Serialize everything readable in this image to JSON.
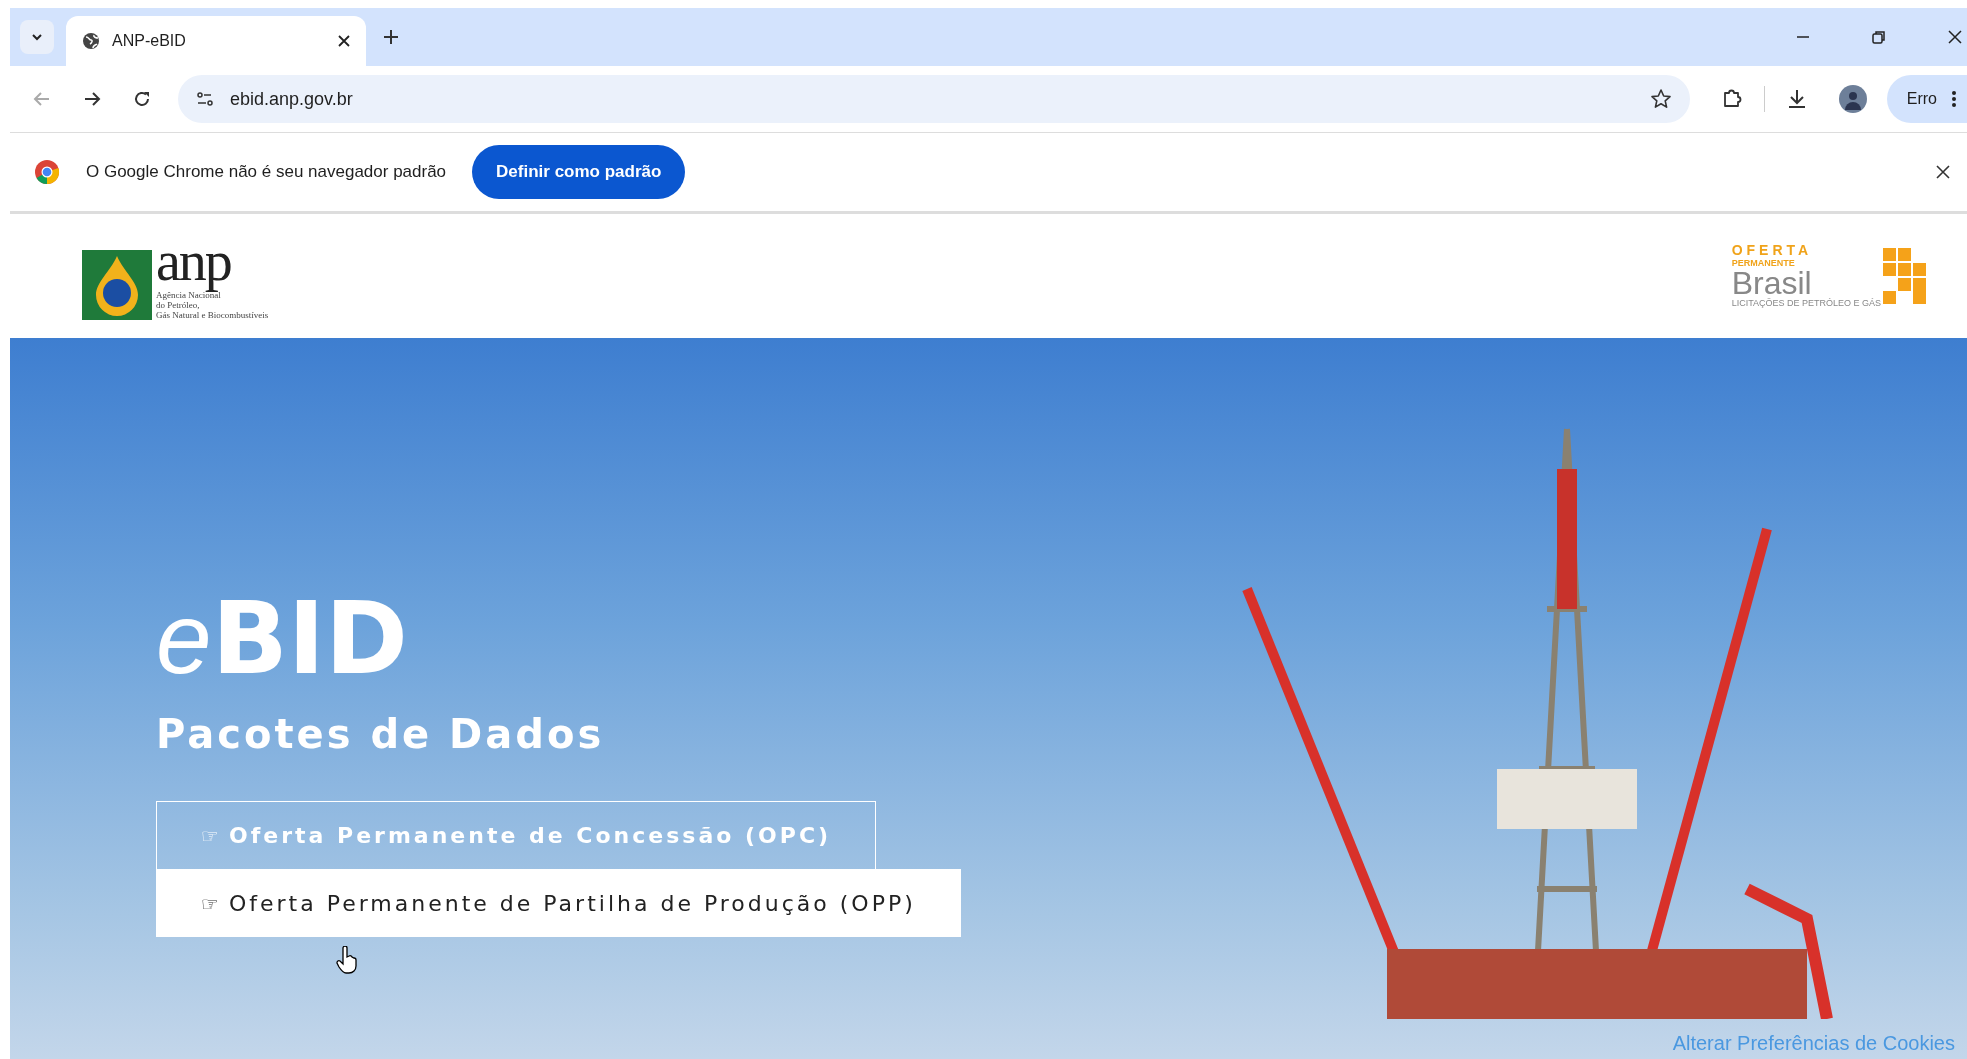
{
  "browser": {
    "tabs": [
      {
        "title": "ANP-eBID",
        "selected": true
      }
    ],
    "url": "ebid.anp.gov.br",
    "profile_label": "Erro"
  },
  "infobar": {
    "message": "O Google Chrome não é seu navegador padrão",
    "button": "Definir como padrão"
  },
  "header": {
    "anp_logo": {
      "word": "anp",
      "subtitle_lines": [
        "Agência Nacional",
        "do Petróleo,",
        "Gás Natural e Biocombustíveis"
      ]
    },
    "oferta_logo": {
      "line_1": "OFERTA",
      "line_2": "PERMANENTE",
      "line_3": "Brasil",
      "line_4": "LICITAÇÕES DE PETRÓLEO E GÁS"
    }
  },
  "hero": {
    "title_light": "e",
    "title_bold": "BID",
    "subtitle": "Pacotes de Dados",
    "links": [
      {
        "icon": "☞",
        "label": "Oferta Permanente de Concessão (OPC)",
        "hovered": false
      },
      {
        "icon": "☞",
        "label": "Oferta Permanente de Partilha de Produção (OPP)",
        "hovered": true
      }
    ],
    "cookie_link": "Alterar Preferências de Cookies"
  }
}
